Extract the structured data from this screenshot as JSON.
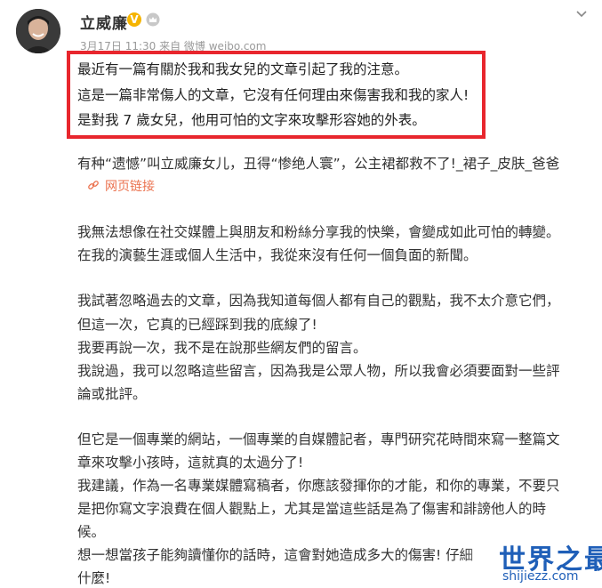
{
  "post": {
    "author": "立威廉",
    "meta": "3月17日 11:30 来自 微博 weibo.com",
    "highlight_lines": [
      "最近有一篇有關於我和我女兒的文章引起了我的注意。",
      "這是一篇非常傷人的文章，它沒有任何理由來傷害我和我的家人!",
      "是對我 7 歲女兒，他用可怕的文字來攻擊形容她的外表。"
    ],
    "shared_title": "有种“遗憾”叫立威廉女儿，丑得“惨绝人寰”，公主裙都救不了!_裙子_皮肤_爸爸",
    "link_label": "网页链接",
    "body_lines": [
      "我無法想像在社交媒體上與朋友和粉絲分享我的快樂，會變成如此可怕的轉變。",
      "在我的演藝生涯或個人生活中，我從來沒有任何一個負面的新聞。",
      "我試著忽略過去的文章，因為我知道每個人都有自己的觀點，我不太介意它們，",
      "但這一次，它真的已經踩到我的底線了!",
      "我要再說一次，我不是在說那些網友們的留言。",
      "我說過，我可以忽略這些留言，因為我是公眾人物，所以我會必須要面對一些評",
      "論或批評。",
      "但它是一個專業的網站，一個專業的自媒體記者，專門研究花時間來寫一整篇文",
      "章來攻擊小孩時，這就真的太過分了!",
      "我建議，作為一名專業媒體寫稿者，你應該發揮你的才能，和你的專業，不要只",
      "是把你寫文字浪費在個人觀點上，尤其是當這些話是為了傷害和誹謗他人的時",
      "候。",
      "想一想當孩子能夠讀懂你的話時，這會對她造成多大的傷害! 仔細",
      "什麼!"
    ]
  },
  "watermark": {
    "title": "世界之最",
    "url": "shijiezz.com"
  },
  "colors": {
    "highlight_border": "#e8262d",
    "link": "#eb7350",
    "verified": "#f5b400",
    "watermark": "#1f5fb8"
  },
  "icons": [
    "avatar",
    "verified-badge-icon",
    "vip-crown-icon",
    "chevron-down-icon",
    "link-icon"
  ]
}
